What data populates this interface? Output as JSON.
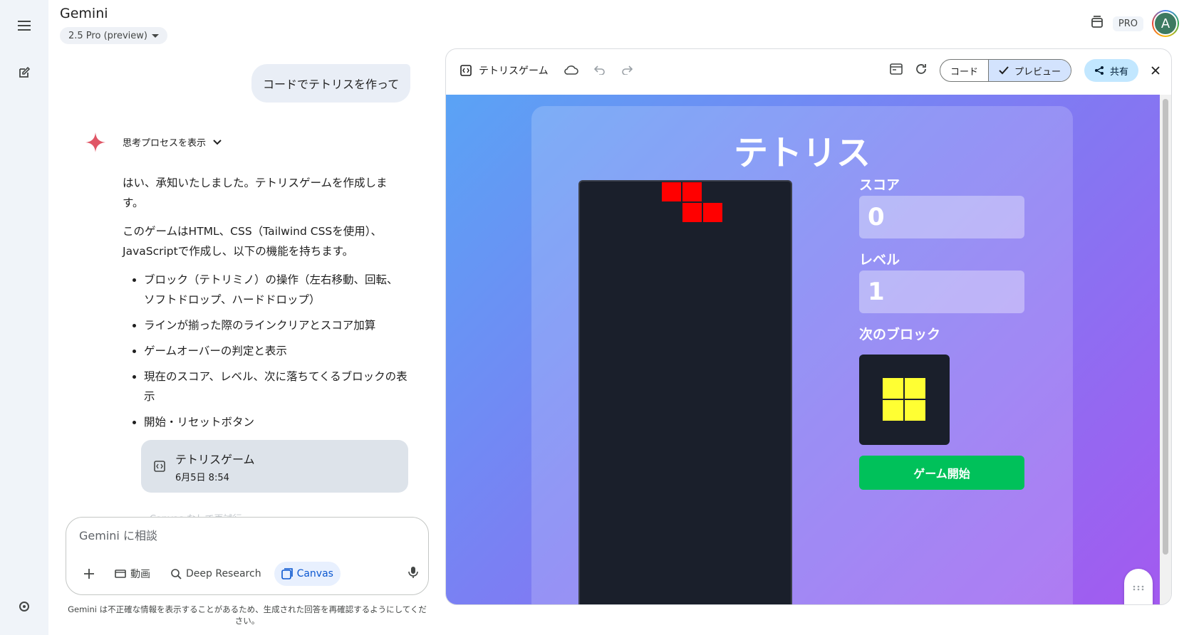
{
  "header": {
    "app_title": "Gemini",
    "model": "2.5 Pro (preview)",
    "pro_badge": "PRO",
    "avatar_initial": "A"
  },
  "chat": {
    "user_message": "コードでテトリスを作って",
    "thinking_label": "思考プロセスを表示",
    "answer_intro": "はい、承知いたしました。テトリスゲームを作成します。",
    "answer_body": "このゲームはHTML、CSS（Tailwind CSSを使用）、JavaScriptで作成し、以下の機能を持ちます。",
    "features": [
      "ブロック（テトリミノ）の操作（左右移動、回転、ソフトドロップ、ハードドロップ）",
      "ラインが揃った際のラインクリアとスコア加算",
      "ゲームオーバーの判定と表示",
      "現在のスコア、レベル、次に落ちてくるブロックの表示",
      "開始・リセットボタン"
    ],
    "canvas_card": {
      "title": "テトリスゲーム",
      "date": "6月5日 8:54"
    },
    "faded_link": "Canvas なしで再試行"
  },
  "composer": {
    "placeholder": "Gemini に相談",
    "tools": {
      "video": "動画",
      "deep_research": "Deep Research",
      "canvas": "Canvas"
    },
    "disclaimer": "Gemini は不正確な情報を表示することがあるため、生成された回答を再確認するようにしてください。"
  },
  "panel": {
    "title": "テトリスゲーム",
    "code_label": "コード",
    "preview_label": "プレビュー",
    "share_label": "共有"
  },
  "game": {
    "title": "テトリス",
    "score_label": "スコア",
    "score": "0",
    "level_label": "レベル",
    "level": "1",
    "next_label": "次のブロック",
    "start_label": "ゲーム開始",
    "colors": {
      "active_piece": "#ff0000",
      "next_piece": "#ffff33",
      "board": "#1a1f2b",
      "start": "#00c15a"
    }
  }
}
